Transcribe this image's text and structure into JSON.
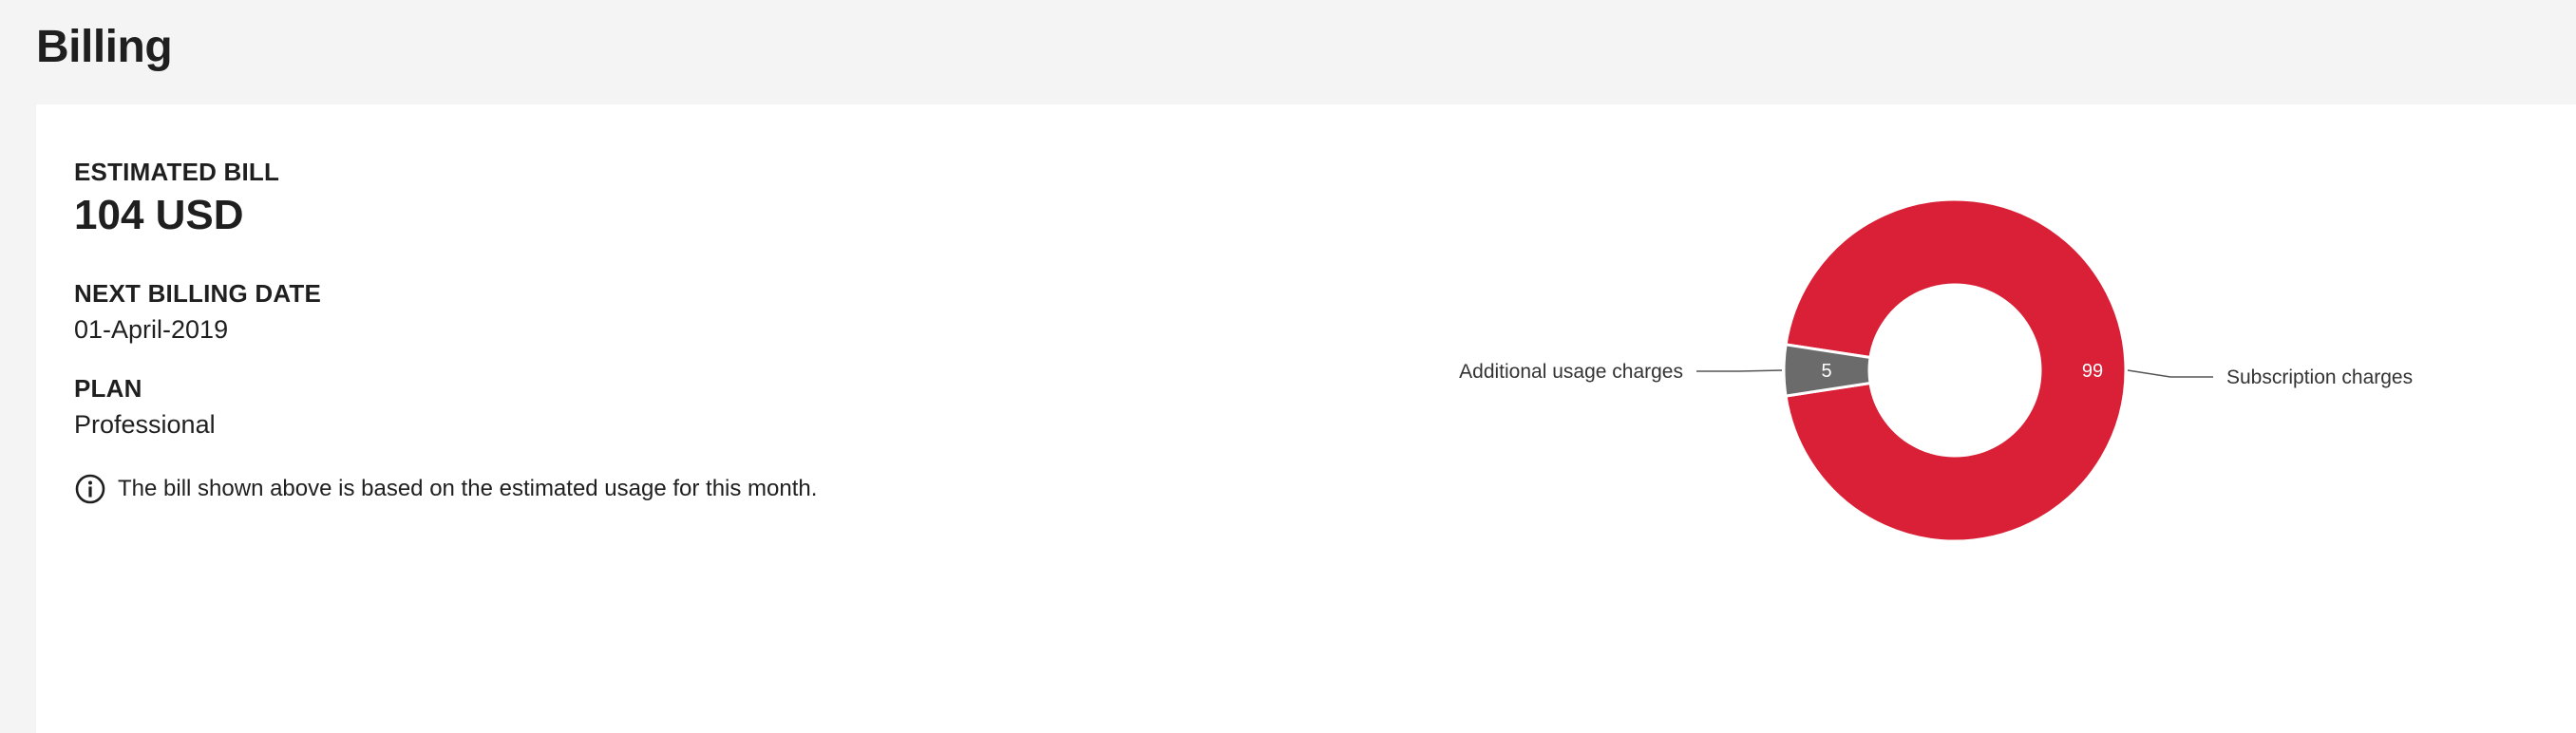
{
  "page": {
    "title": "Billing"
  },
  "summary": {
    "estimated_bill_label": "ESTIMATED BILL",
    "estimated_bill_value": "104 USD",
    "next_billing_date_label": "NEXT BILLING DATE",
    "next_billing_date_value": "01-April-2019",
    "plan_label": "PLAN",
    "plan_value": "Professional",
    "note_icon": "info-icon",
    "note_text": "The bill shown above is based on the estimated usage for this month."
  },
  "chart_data": {
    "type": "pie",
    "categories": [
      "Subscription charges",
      "Additional usage charges"
    ],
    "values": [
      99,
      5
    ],
    "colors": [
      "#da2036",
      "#6b6b6b"
    ]
  }
}
